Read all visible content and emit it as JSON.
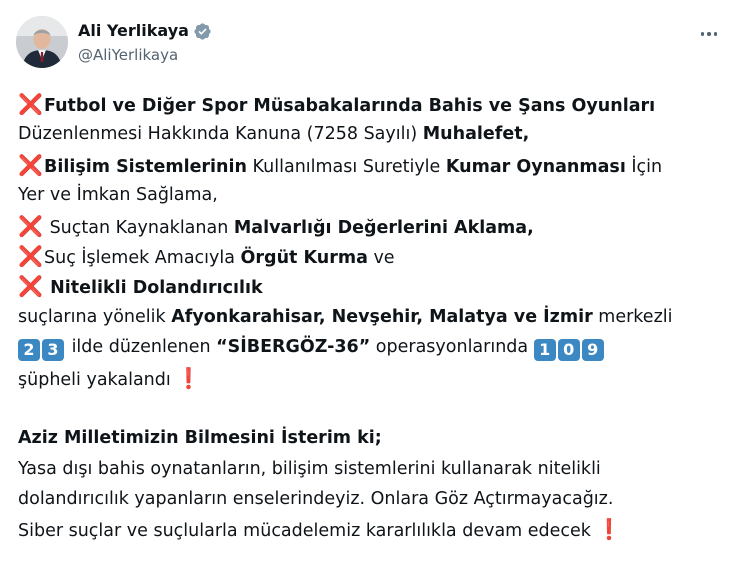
{
  "author": {
    "name": "Ali Yerlikaya",
    "handle": "@AliYerlikaya",
    "verified_color": "#829aab"
  },
  "icons": {
    "cross": "❌",
    "exclamation": "❗"
  },
  "tweet": {
    "l1": "Futbol ve Diğer Spor Müsabakalarında Bahis ve Şans Oyunları",
    "l2a": "Düzenlenmesi Hakkında Kanuna (7258 Sayılı) ",
    "l2b": "Muhalefet,",
    "l3a": "Bilişim Sistemlerinin",
    "l3b": " Kullanılması Suretiyle ",
    "l3c": "Kumar Oynanması",
    "l3d": " İçin",
    "l4": "Yer ve İmkan Sağlama,",
    "l5a": " Suçtan Kaynaklanan ",
    "l5b": "Malvarlığı Değerlerini Aklama,",
    "l6a": "Suç İşlemek Amacıyla ",
    "l6b": "Örgüt Kurma",
    "l6c": " ve",
    "l7": " Nitelikli Dolandırıcılık",
    "l8a": "suçlarına yönelik  ",
    "l8b": "Afyonkarahisar, Nevşehir, Malatya ve İzmir",
    "l8c": " merkezli",
    "num1a": "2",
    "num1b": "3",
    "l9a": " ilde düzenlenen ",
    "l9b": "“SİBERGÖZ-36”",
    "l9c": " operasyonlarında ",
    "num2a": "1",
    "num2b": "0",
    "num2c": "9",
    "l10": "şüpheli yakalandı ",
    "l11": "Aziz Milletimizin Bilmesini İsterim ki;",
    "l12": "Yasa dışı bahis oynatanların, bilişim sistemlerini kullanarak nitelikli",
    "l13": "dolandırıcılık yapanların enselerindeyiz. Onlara Göz Açtırmayacağız.",
    "l14": "Siber suçlar ve suçlularla mücadelemiz kararlılıkla devam edecek "
  }
}
